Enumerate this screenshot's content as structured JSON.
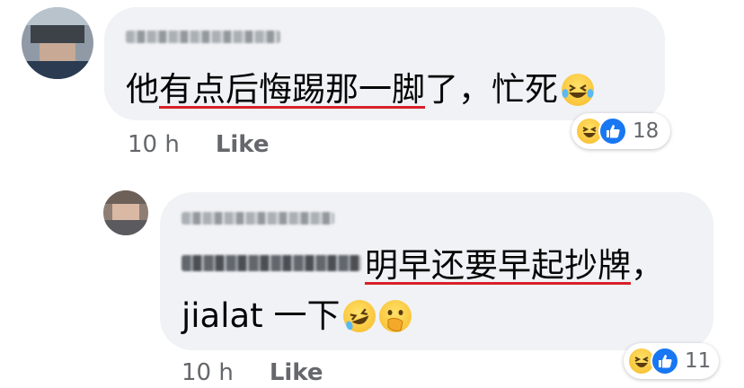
{
  "comments": [
    {
      "text_plain": "他",
      "text_underlined": "有点后悔踢那一脚",
      "text_rest": "了，忙死",
      "emoji": "tears-of-joy-emoji",
      "time": "10 h",
      "like_label": "Like",
      "reaction_count": "18",
      "reactions": [
        "haha-icon",
        "like-icon"
      ]
    },
    {
      "text_underlined": "明早还要早起抄牌",
      "text_rest": "，",
      "line2": "jialat 一下",
      "emojis": [
        "rofl-emoji",
        "hand-over-mouth-emoji"
      ],
      "time": "10 h",
      "like_label": "Like",
      "reaction_count": "11",
      "reactions": [
        "haha-icon",
        "like-icon"
      ]
    }
  ],
  "colors": {
    "bubble": "#f0f2f5",
    "underline": "#d8202a",
    "meta": "#65676b",
    "like_blue": "#1877f2",
    "haha_yellow": "#f7b928"
  }
}
